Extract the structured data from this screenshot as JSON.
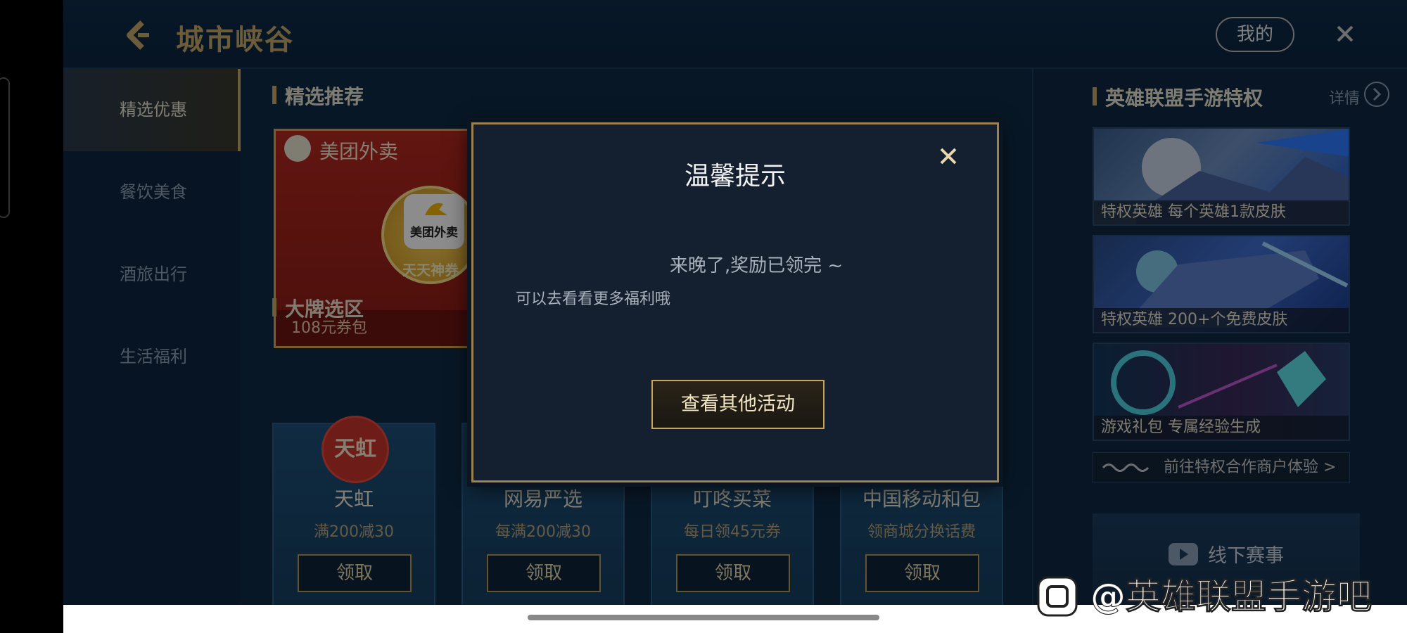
{
  "header": {
    "title": "城市峡谷",
    "my_label": "我的"
  },
  "leftnav": {
    "items": [
      {
        "label": "精选优惠"
      },
      {
        "label": "餐饮美食"
      },
      {
        "label": "酒旅出行"
      },
      {
        "label": "生活福利"
      }
    ]
  },
  "main": {
    "featured_title": "精选推荐",
    "meituan": {
      "name": "美团外卖",
      "badge_logo": "美团外卖",
      "badge_sub": "天天神券",
      "footer": "108元券包"
    },
    "brands_title": "大牌选区",
    "brands": [
      {
        "logo": "天虹",
        "name": "天虹",
        "desc": "满200减30",
        "button": "领取"
      },
      {
        "name": "网易严选",
        "desc": "每满200减30",
        "button": "领取"
      },
      {
        "name": "叮咚买菜",
        "desc": "每日领45元券",
        "button": "领取"
      },
      {
        "name": "中国移动和包",
        "desc": "领商城分换话费",
        "button": "领取"
      }
    ]
  },
  "right": {
    "title": "英雄联盟手游特权",
    "detail": "详情",
    "cards": [
      {
        "label": "特权英雄 每个英雄1款皮肤"
      },
      {
        "label": "特权英雄 200+个免费皮肤"
      },
      {
        "label": "游戏礼包 专属经验生成"
      }
    ],
    "partner_link": "前往特权合作商户体验 >",
    "offline_label": "线下赛事"
  },
  "modal": {
    "title": "温馨提示",
    "message_primary": "来晚了,奖励已领完 ~",
    "message_secondary": "可以去看看更多福利哦",
    "button_label": "查看其他活动"
  },
  "watermark": {
    "text": "@英雄联盟手游吧"
  },
  "colors": {
    "accent_gold": "#c7a868",
    "bg_navy": "#0f2a46",
    "modal_bg": "#14202f"
  }
}
